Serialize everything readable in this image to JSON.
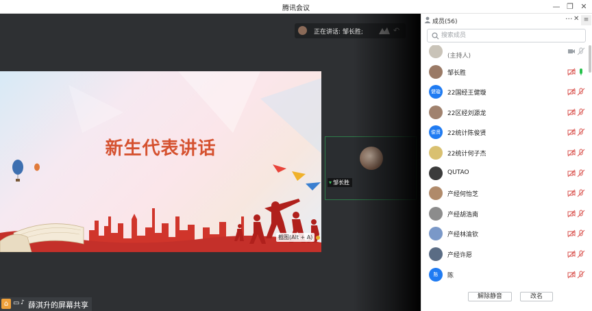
{
  "window": {
    "title": "腾讯会议",
    "minimize": "—",
    "maximize": "❐",
    "close": "✕"
  },
  "speaking": {
    "label": "正在讲话: 邹长胜;"
  },
  "slide": {
    "headline": "新生代表讲话"
  },
  "crop_tooltip": "截图(Alt + A)",
  "video_tile": {
    "name": "邹长胜"
  },
  "share_bar": {
    "text": "薛淇升的屏幕共享"
  },
  "panel": {
    "title": "成员(56)",
    "more": "···",
    "close": "✕",
    "menu": "≡",
    "search_placeholder": "搜索成员",
    "members": [
      {
        "name": "",
        "sub": "(主持人)",
        "avatar_color": "#c9c3b8",
        "avatar_text": "",
        "mic": "muted-grey",
        "video": "on"
      },
      {
        "name": "邹长胜",
        "avatar_color": "#9a7a66",
        "avatar_text": "",
        "mic": "speaking",
        "video": "off"
      },
      {
        "name": "22国经王健璇",
        "avatar_color": "#1f7bf2",
        "avatar_text": "健璇",
        "mic": "muted",
        "video": "off"
      },
      {
        "name": "22区经刘源龙",
        "avatar_color": "#a0826e",
        "avatar_text": "",
        "mic": "muted",
        "video": "off"
      },
      {
        "name": "22统计陈俊贤",
        "avatar_color": "#1f7bf2",
        "avatar_text": "俊贤",
        "mic": "muted",
        "video": "off"
      },
      {
        "name": "22统计何子杰",
        "avatar_color": "#d9c070",
        "avatar_text": "",
        "mic": "muted",
        "video": "off"
      },
      {
        "name": "QUTAO",
        "avatar_color": "#3b3b3b",
        "avatar_text": "",
        "mic": "muted",
        "video": "off"
      },
      {
        "name": "产经何怡芝",
        "avatar_color": "#b08a6a",
        "avatar_text": "",
        "mic": "muted",
        "video": "off"
      },
      {
        "name": "产经胡浩南",
        "avatar_color": "#8c8c8c",
        "avatar_text": "",
        "mic": "muted",
        "video": "off"
      },
      {
        "name": "产经林渝钦",
        "avatar_color": "#7a98c8",
        "avatar_text": "",
        "mic": "muted",
        "video": "off"
      },
      {
        "name": "产经许愿",
        "avatar_color": "#5a6c84",
        "avatar_text": "",
        "mic": "muted",
        "video": "off"
      },
      {
        "name": "陈",
        "avatar_color": "#1f7bf2",
        "avatar_text": "陈",
        "mic": "muted",
        "video": "off"
      }
    ],
    "unmute_all": "解除静音",
    "rename": "改名"
  },
  "colors": {
    "mic_muted": "#d9534f",
    "mic_speaking": "#27c24c",
    "accent": "#1f7bf2",
    "headline": "#d5512f"
  }
}
